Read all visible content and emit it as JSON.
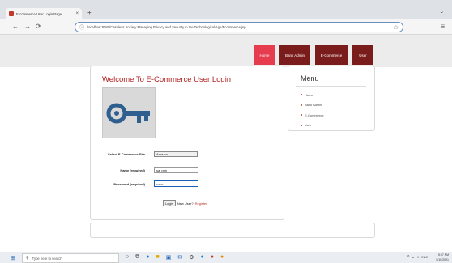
{
  "browser": {
    "tab_title": "E-commerce User Login Page",
    "new_tab": "+",
    "url": "localhost:8080/Cashless Society Managing Privacy and Security in the Technological Age/Ecommerce.jsp",
    "url_prefix": "ⓘ",
    "nav_back": "←",
    "nav_forward": "→",
    "nav_refresh": "⟳",
    "bookmark": "☆",
    "menu": "≡",
    "chevron": "⌄"
  },
  "site": {
    "nav_items": [
      {
        "label": "Home"
      },
      {
        "label": "Bank Admin"
      },
      {
        "label": "E-Commerce"
      },
      {
        "label": "User"
      }
    ]
  },
  "login": {
    "title": "Welcome To E-Commerce User Login",
    "site_label": "Select E-Commerce Site",
    "site_value": "Amazon",
    "name_label": "Name (required)",
    "name_value": "sai ram",
    "password_label": "Password (required)",
    "password_value": "••••••",
    "login_button": "Login",
    "new_user_text": "New User?",
    "register_link": "Register"
  },
  "menu": {
    "title": "Menu",
    "items": [
      "Home",
      "Bank Admin",
      "E-Commerce",
      "User"
    ]
  },
  "taskbar": {
    "search_placeholder": "Type here to search",
    "time": "5:07 PM",
    "date": "5/15/2021",
    "lang": "ENG"
  },
  "colors": {
    "nav_active": "#e63c4d",
    "nav_default": "#7a1c1c",
    "title_red": "#b22222",
    "key_blue": "#2f5f8f"
  }
}
